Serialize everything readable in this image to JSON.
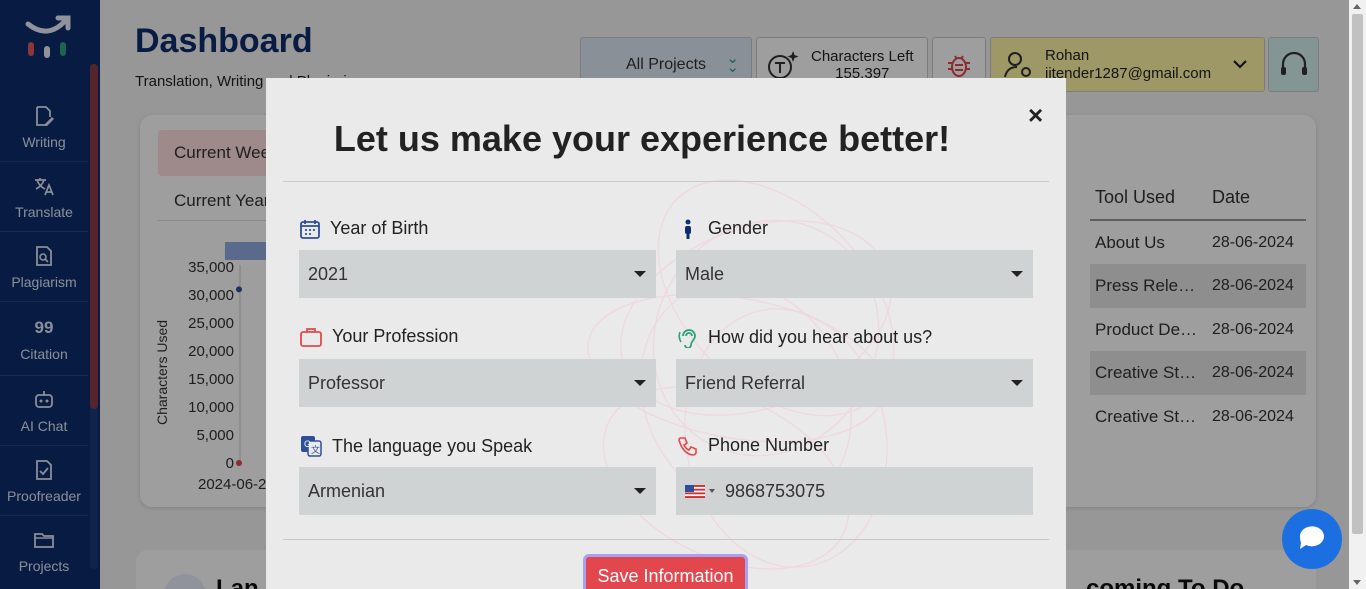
{
  "sidebar": {
    "items": [
      {
        "label": "Writing",
        "icon": "edit-doc-icon"
      },
      {
        "label": "Translate",
        "icon": "translate-icon"
      },
      {
        "label": "Plagiarism",
        "icon": "plagiarism-icon"
      },
      {
        "label": "Citation",
        "icon": "quote-icon",
        "glyph": "99"
      },
      {
        "label": "AI Chat",
        "icon": "robot-icon"
      },
      {
        "label": "Proofreader",
        "icon": "proofread-icon"
      },
      {
        "label": "Projects",
        "icon": "folder-icon"
      }
    ]
  },
  "header": {
    "title": "Dashboard",
    "subtitle": "Translation, Writing and Plagiarism",
    "projects_select": "All Projects",
    "characters_left_label": "Characters Left",
    "characters_left_value": "155,397",
    "user_name": "Rohan",
    "user_email": "jitender1287@gmail.com"
  },
  "dashboard": {
    "tab_week": "Current Week",
    "tab_year": "Current Year",
    "chart": {
      "ylabel": "Characters Used",
      "yticks": [
        "35,000",
        "30,000",
        "25,000",
        "20,000",
        "15,000",
        "10,000",
        "5,000",
        "0"
      ],
      "xtick": "2024-06-2"
    },
    "table": {
      "headers": {
        "tool": "Tool Used",
        "date": "Date"
      },
      "rows": [
        {
          "tool": "About Us",
          "date": "28-06-2024"
        },
        {
          "tool": "Press Release",
          "date": "28-06-2024"
        },
        {
          "tool": "Product Description",
          "date": "28-06-2024"
        },
        {
          "tool": "Creative Story",
          "date": "28-06-2024"
        },
        {
          "tool": "Creative Story",
          "date": "28-06-2024"
        }
      ]
    },
    "bottom_left": "Lan",
    "bottom_right": "coming To Do"
  },
  "chart_data": {
    "type": "line",
    "title": "",
    "xlabel": "",
    "ylabel": "Characters Used",
    "ylim": [
      0,
      35000
    ],
    "x": [
      "2024-06-2"
    ],
    "series": [
      {
        "values": [
          31000,
          0
        ]
      }
    ]
  },
  "modal": {
    "title": "Let us make your experience better!",
    "close_label": "×",
    "fields": {
      "year_of_birth": {
        "label": "Year of Birth",
        "value": "2021"
      },
      "gender": {
        "label": "Gender",
        "value": "Male"
      },
      "profession": {
        "label": "Your Profession",
        "value": "Professor"
      },
      "heard_about": {
        "label": "How did you hear about us?",
        "value": "Friend Referral"
      },
      "language": {
        "label": "The language you Speak",
        "value": "Armenian"
      },
      "phone": {
        "label": "Phone Number",
        "value": "9868753075"
      }
    },
    "save_label": "Save Information"
  },
  "colors": {
    "sidebar": "#0d2d6b",
    "accent_red": "#e3474e",
    "field_bg": "#cfd3d3",
    "chat": "#1c6fe0"
  }
}
